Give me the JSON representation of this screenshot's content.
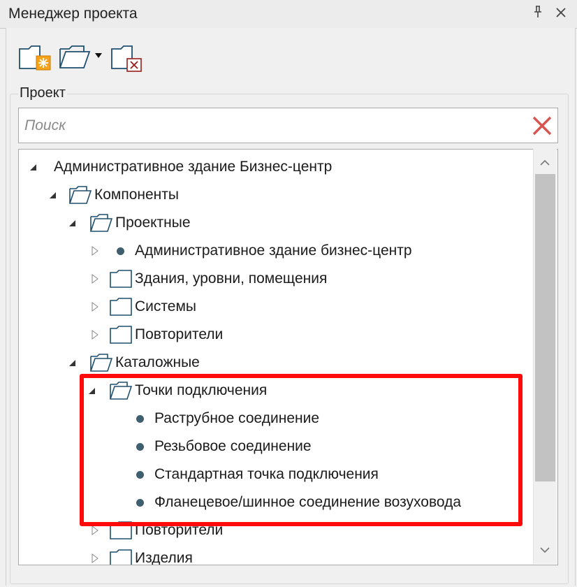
{
  "window": {
    "title": "Менеджер проекта",
    "pin_glyph": "ᛁ",
    "close_glyph": "✕"
  },
  "toolbar": {
    "buttons": [
      {
        "name": "new-project",
        "icon": "folder-new-icon"
      },
      {
        "name": "open-project",
        "icon": "folder-open-icon"
      },
      {
        "name": "close-project",
        "icon": "folder-close-icon"
      }
    ]
  },
  "project": {
    "group_label": "Проект",
    "search": {
      "placeholder": "Поиск",
      "value": "",
      "clear_icon": "clear-icon",
      "clear_color": "#d9534f"
    },
    "tree": {
      "root": "Административное здание Бизнес-центр",
      "components": "Компоненты",
      "design": "Проектные",
      "design_items": [
        "Административное здание бизнес-центр",
        "Здания, уровни, помещения",
        "Системы",
        "Повторители"
      ],
      "catalog": "Каталожные",
      "connection_points": "Точки подключения",
      "connection_items": [
        "Раструбное соединение",
        "Резьбовое соединение",
        "Стандартная точка подключения",
        "Фланецевое/шинное соединение возуховода"
      ],
      "catalog_items": [
        "Повторители",
        "Изделия"
      ]
    }
  },
  "colors": {
    "highlight": "#ff0a0a",
    "folder_stroke": "#1f4f6f",
    "node_dot": "#3f5f6f"
  }
}
